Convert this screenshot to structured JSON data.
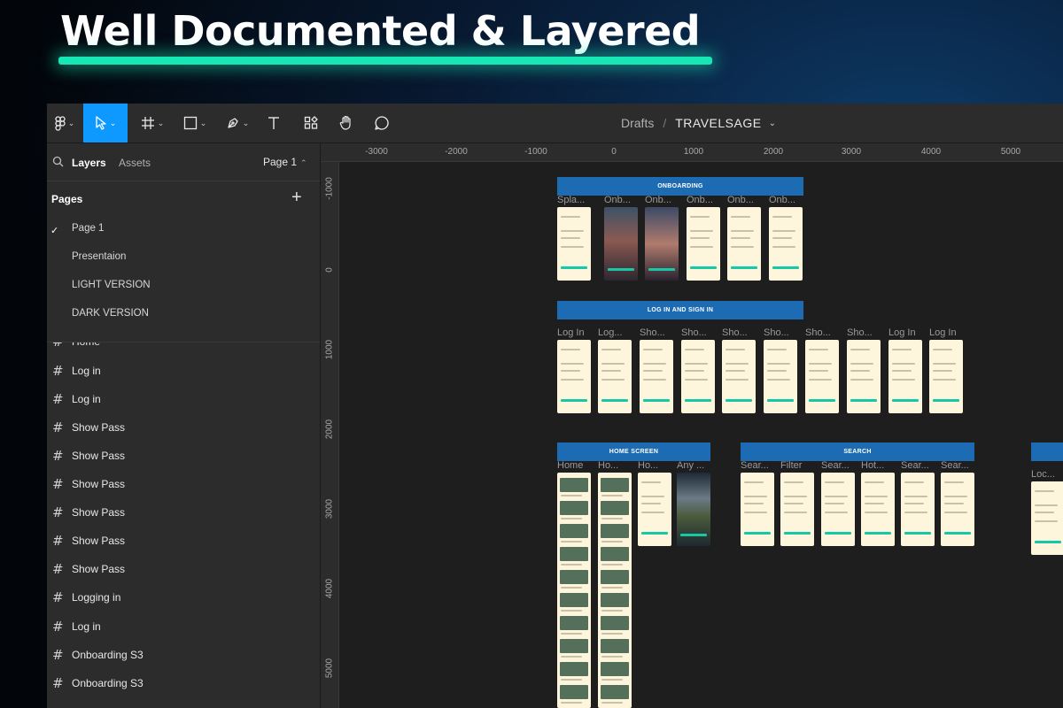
{
  "hero": {
    "title": "Well Documented & Layered"
  },
  "toolbar": {
    "tools": [
      "figma-menu-icon",
      "move-tool-icon",
      "frame-tool-icon",
      "shape-tool-icon",
      "pen-tool-icon",
      "text-tool-icon",
      "resources-icon",
      "hand-tool-icon",
      "comment-icon"
    ],
    "active_tool": "move-tool-icon",
    "accent": "#0d99ff"
  },
  "breadcrumb": {
    "location": "Drafts",
    "separator": "/",
    "file": "TRAVELSAGE"
  },
  "sidebar": {
    "tabs": {
      "layers": "Layers",
      "assets": "Assets"
    },
    "page_select": "Page 1",
    "pages_header": "Pages",
    "pages": [
      "Page 1",
      "Presentaion",
      "LIGHT VERSION",
      "DARK VERSION"
    ],
    "current_page": "Page 1",
    "layers": [
      "Home",
      "Log in",
      "Log in",
      "Show Pass",
      "Show Pass",
      "Show Pass",
      "Show Pass",
      "Show Pass",
      "Show Pass",
      "Logging in",
      "Log in",
      "Onboarding S3",
      "Onboarding S3"
    ]
  },
  "rulers": {
    "x": [
      "-3000",
      "-2000",
      "-1000",
      "0",
      "1000",
      "2000",
      "3000",
      "4000",
      "5000"
    ],
    "y": [
      "-1000",
      "0",
      "1000",
      "2000",
      "3000",
      "4000",
      "5000"
    ]
  },
  "canvas": {
    "sections": {
      "onboarding": "ONBOARDING",
      "login": "LOG IN AND SIGN IN",
      "home": "HOME SCREEN",
      "search": "SEARCH"
    },
    "onboarding_frames": [
      "Spla...",
      "Onb...",
      "Onb...",
      "Onb...",
      "Onb...",
      "Onb..."
    ],
    "login_frames": [
      "Log In",
      "Log...",
      "Sho...",
      "Sho...",
      "Sho...",
      "Sho...",
      "Sho...",
      "Sho...",
      "Log In",
      "Log In"
    ],
    "home_frames": [
      "Home",
      "Ho...",
      "Ho...",
      "Any ..."
    ],
    "search_frames": [
      "Sear...",
      "Filter",
      "Sear...",
      "Hot...",
      "Sear...",
      "Sear..."
    ],
    "extra_frames": [
      "Loc..."
    ],
    "section_color": "#1d6bb2"
  }
}
